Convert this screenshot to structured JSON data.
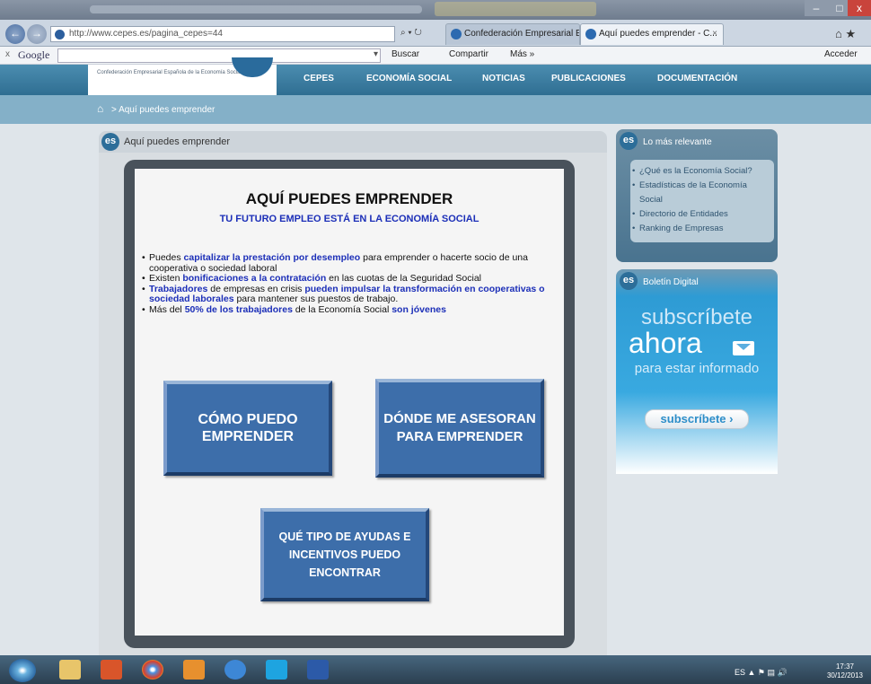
{
  "browser": {
    "address": "http://www.cepes.es/pagina_cepes=44",
    "address_domain": "cepes.es",
    "tabs": [
      {
        "label": "Confederación Empresarial Esp..."
      },
      {
        "label": "Aquí puedes emprender - C..."
      }
    ],
    "window_controls": {
      "minimize": "–",
      "maximize": "□",
      "close": "x"
    }
  },
  "google_toolbar": {
    "close": "x",
    "logo": "Google",
    "buscar": "Buscar",
    "compartir": "Compartir",
    "mas": "Más »",
    "acceder": "Acceder"
  },
  "site": {
    "logo_text": "Confederación Empresarial Española de la Economía Social",
    "menu": [
      "CEPES",
      "ECONOMÍA SOCIAL",
      "NOTICIAS",
      "PUBLICACIONES",
      "DOCUMENTACIÓN"
    ],
    "breadcrumb": "> Aquí puedes emprender"
  },
  "main": {
    "badge": "es",
    "header": "Aquí puedes emprender",
    "title": "AQUÍ PUEDES EMPRENDER",
    "subtitle": "TU FUTURO EMPLEO ESTÁ EN LA ECONOMÍA SOCIAL",
    "bullets": [
      {
        "a": "Puedes ",
        "b": "capitalizar la prestación por desempleo",
        "c": " para emprender o hacerte socio de una cooperativa o sociedad laboral"
      },
      {
        "a": "Existen ",
        "b": "bonificaciones a la contratación",
        "c": " en las cuotas de la Seguridad Social"
      },
      {
        "b1": "Trabajadores",
        "a": " de empresas en crisis ",
        "b2": "pueden impulsar la transformación en cooperativas o sociedad laborales",
        "c": " para mantener sus puestos de trabajo."
      },
      {
        "a": "Más del ",
        "b1": "50% de los trabajadores",
        "a2": " de la Economía Social ",
        "b2": "son jóvenes"
      }
    ],
    "buttons": [
      {
        "label": "CÓMO PUEDO EMPRENDER"
      },
      {
        "label": "DÓNDE ME ASESORAN PARA EMPRENDER"
      },
      {
        "label": "QUÉ TIPO DE AYUDAS E INCENTIVOS PUEDO ENCONTRAR"
      }
    ]
  },
  "sidebar": {
    "relevante": {
      "badge": "es",
      "title": "Lo más relevante",
      "items": [
        "¿Qué es la Economía Social?",
        "Estadísticas de la Economía Social",
        "Directorio de Entidades",
        "Ranking de Empresas"
      ]
    },
    "boletin": {
      "badge": "es",
      "title": "Boletín Digital",
      "line1": "subscríbete",
      "line2": "ahora",
      "line3": "para estar informado",
      "button": "subscríbete ›"
    }
  },
  "taskbar": {
    "lang": "ES",
    "time": "17:37",
    "date": "30/12/2013"
  }
}
